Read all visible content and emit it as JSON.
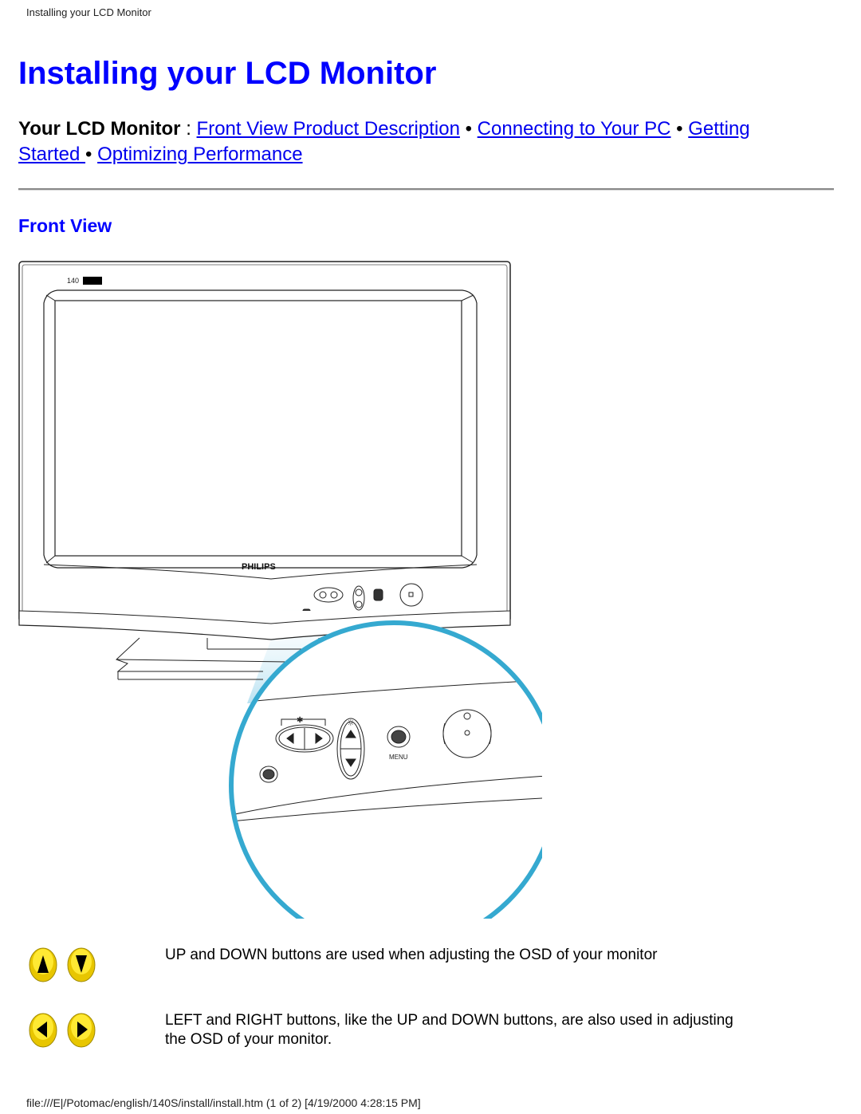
{
  "running_head": "Installing your LCD Monitor",
  "page_title": "Installing your LCD Monitor",
  "nav": {
    "lead": "Your LCD Monitor",
    "separator_colon": " : ",
    "bullet": " • ",
    "links": [
      {
        "label": "Front View Product Description"
      },
      {
        "label": "Connecting to Your PC"
      },
      {
        "label": "Getting Started "
      },
      {
        "label": "Optimizing Performance"
      }
    ]
  },
  "section_title": "Front View",
  "figure": {
    "model_label": "140",
    "brand_label": "PHILIPS",
    "menu_label": "MENU",
    "accent_color": "#35a9d0",
    "highlight_color": "#c8e9f5"
  },
  "descriptions": [
    {
      "icons": [
        "up-arrow",
        "down-arrow"
      ],
      "text": "UP and DOWN buttons are used when adjusting the OSD of your monitor"
    },
    {
      "icons": [
        "left-arrow",
        "right-arrow"
      ],
      "text": "LEFT and RIGHT buttons, like the UP and DOWN buttons, are also used in adjusting the OSD of your monitor."
    }
  ],
  "footer": "file:///E|/Potomac/english/140S/install/install.htm (1 of 2) [4/19/2000 4:28:15 PM]"
}
